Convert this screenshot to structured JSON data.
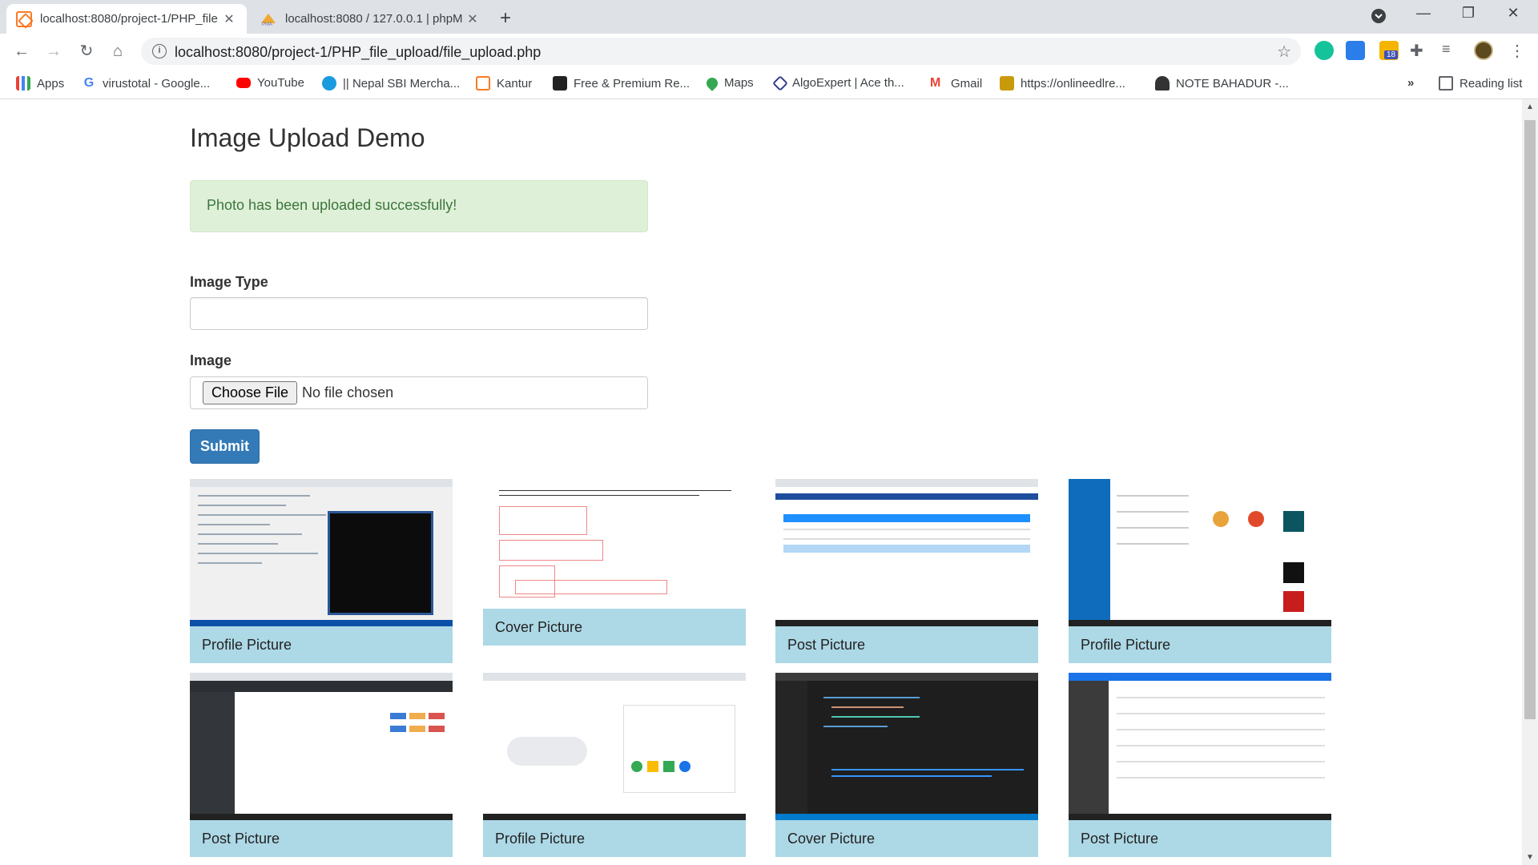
{
  "browser": {
    "tabs": [
      {
        "title": "localhost:8080/project-1/PHP_file",
        "close": "✕"
      },
      {
        "title": "localhost:8080 / 127.0.0.1 | phpM",
        "close": "✕"
      }
    ],
    "new_tab": "+",
    "url": "localhost:8080/project-1/PHP_file_upload/file_upload.php",
    "ext_badge": "18",
    "window": {
      "minimize": "—",
      "restore": "❐",
      "close": "✕"
    },
    "bookmarks": [
      {
        "label": "Apps",
        "icon": "apps-grid-icon",
        "color": "#4285f4"
      },
      {
        "label": "virustotal - Google...",
        "icon": "google-icon",
        "color": "#ea4335"
      },
      {
        "label": "YouTube",
        "icon": "youtube-icon",
        "color": "#ff0000"
      },
      {
        "label": "|| Nepal SBI Mercha...",
        "icon": "sbi-icon",
        "color": "#1a9be0"
      },
      {
        "label": "Kantur",
        "icon": "xampp-icon",
        "color": "#fb7a24"
      },
      {
        "label": "Free & Premium Re...",
        "icon": "bookmark-site-icon",
        "color": "#222222"
      },
      {
        "label": "Maps",
        "icon": "maps-pin-icon",
        "color": "#34a853"
      },
      {
        "label": "AlgoExpert | Ace th...",
        "icon": "algoexpert-icon",
        "color": "#2f3e8a"
      },
      {
        "label": "Gmail",
        "icon": "gmail-icon",
        "color": "#ea4335"
      },
      {
        "label": "https://onlineedlre...",
        "icon": "bookmark-site-icon",
        "color": "#c99a0b"
      },
      {
        "label": "NOTE BAHADUR -...",
        "icon": "bookmark-site-icon",
        "color": "#333333"
      }
    ],
    "more_bookmarks": "»",
    "reading_list": "Reading list"
  },
  "page": {
    "title": "Image Upload Demo",
    "alert": "Photo has been uploaded successfully!",
    "image_type_label": "Image Type",
    "image_type_value": "",
    "image_label": "Image",
    "choose_file": "Choose File",
    "no_file": "No file chosen",
    "submit": "Submit",
    "gallery": [
      {
        "caption": "Profile Picture",
        "thumb": "code-editor"
      },
      {
        "caption": "Cover Picture",
        "thumb": "math-notes"
      },
      {
        "caption": "Post Picture",
        "thumb": "table-web"
      },
      {
        "caption": "Profile Picture",
        "thumb": "mail-app"
      },
      {
        "caption": "Post Picture",
        "thumb": "admin-panel"
      },
      {
        "caption": "Profile Picture",
        "thumb": "google-search"
      },
      {
        "caption": "Cover Picture",
        "thumb": "dark-editor"
      },
      {
        "caption": "Post Picture",
        "thumb": "phpmyadmin"
      }
    ]
  },
  "colors": {
    "primary": "#337ab7",
    "success_bg": "#dff0d8",
    "success_text": "#3c763d",
    "caption_bg": "#add8e6"
  }
}
